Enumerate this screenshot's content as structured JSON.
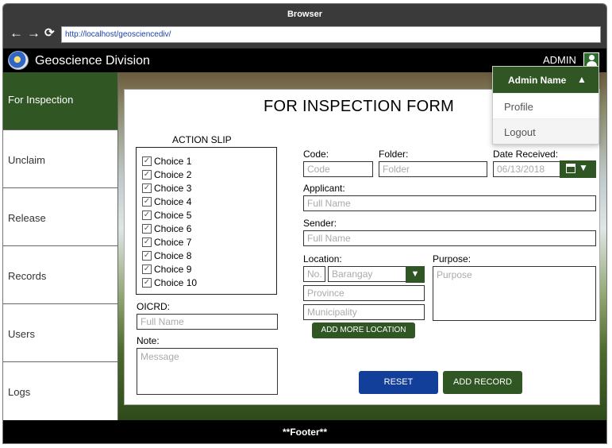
{
  "browser": {
    "title": "Browser",
    "url": "http://localhost/geosciencediv/",
    "back": "←",
    "forward": "→",
    "reload": "⟳"
  },
  "app": {
    "name": "Geoscience Division",
    "user_label": "ADMIN"
  },
  "sidebar": {
    "items": [
      {
        "label": "For Inspection",
        "active": true
      },
      {
        "label": "Unclaim"
      },
      {
        "label": "Release"
      },
      {
        "label": "Records"
      },
      {
        "label": "Users"
      },
      {
        "label": "Logs"
      }
    ]
  },
  "form": {
    "title": "FOR INSPECTION FORM",
    "action_slip": {
      "title": "ACTION SLIP",
      "choices": [
        {
          "label": "Choice 1",
          "checked": true
        },
        {
          "label": "Choice 2",
          "checked": true
        },
        {
          "label": "Choice 3",
          "checked": true
        },
        {
          "label": "Choice 4",
          "checked": true
        },
        {
          "label": "Choice 5",
          "checked": true
        },
        {
          "label": "Choice 6",
          "checked": true
        },
        {
          "label": "Choice 7",
          "checked": true
        },
        {
          "label": "Choice 8",
          "checked": true
        },
        {
          "label": "Choice 9",
          "checked": true
        },
        {
          "label": "Choice 10",
          "checked": true
        }
      ],
      "check_mark": "✓"
    },
    "oicrd": {
      "label": "OICRD:",
      "placeholder": "Full Name"
    },
    "note": {
      "label": "Note:",
      "placeholder": "Message"
    },
    "code": {
      "label": "Code:",
      "placeholder": "Code"
    },
    "folder": {
      "label": "Folder:",
      "placeholder": "Folder"
    },
    "date_received": {
      "label": "Date Received:",
      "value": "06/13/2018",
      "caret": "▼"
    },
    "applicant": {
      "label": "Applicant:",
      "placeholder": "Full Name"
    },
    "sender": {
      "label": "Sender:",
      "placeholder": "Full Name"
    },
    "location": {
      "label": "Location:",
      "no_placeholder": "No.",
      "barangay_placeholder": "Barangay",
      "province_placeholder": "Province",
      "municipality_placeholder": "Municipality",
      "caret": "▼",
      "add_more_label": "ADD MORE LOCATION"
    },
    "purpose": {
      "label": "Purpose:",
      "placeholder": "Purpose"
    },
    "reset_label": "RESET",
    "add_record_label": "ADD RECORD"
  },
  "user_menu": {
    "name": "Admin Name",
    "caret": "▲",
    "items": [
      "Profile",
      "Logout"
    ]
  },
  "footer": {
    "text": "**Footer**"
  },
  "colors": {
    "primary_green": "#2f5623",
    "reset_blue": "#123f9a",
    "bar_black": "#000000"
  }
}
